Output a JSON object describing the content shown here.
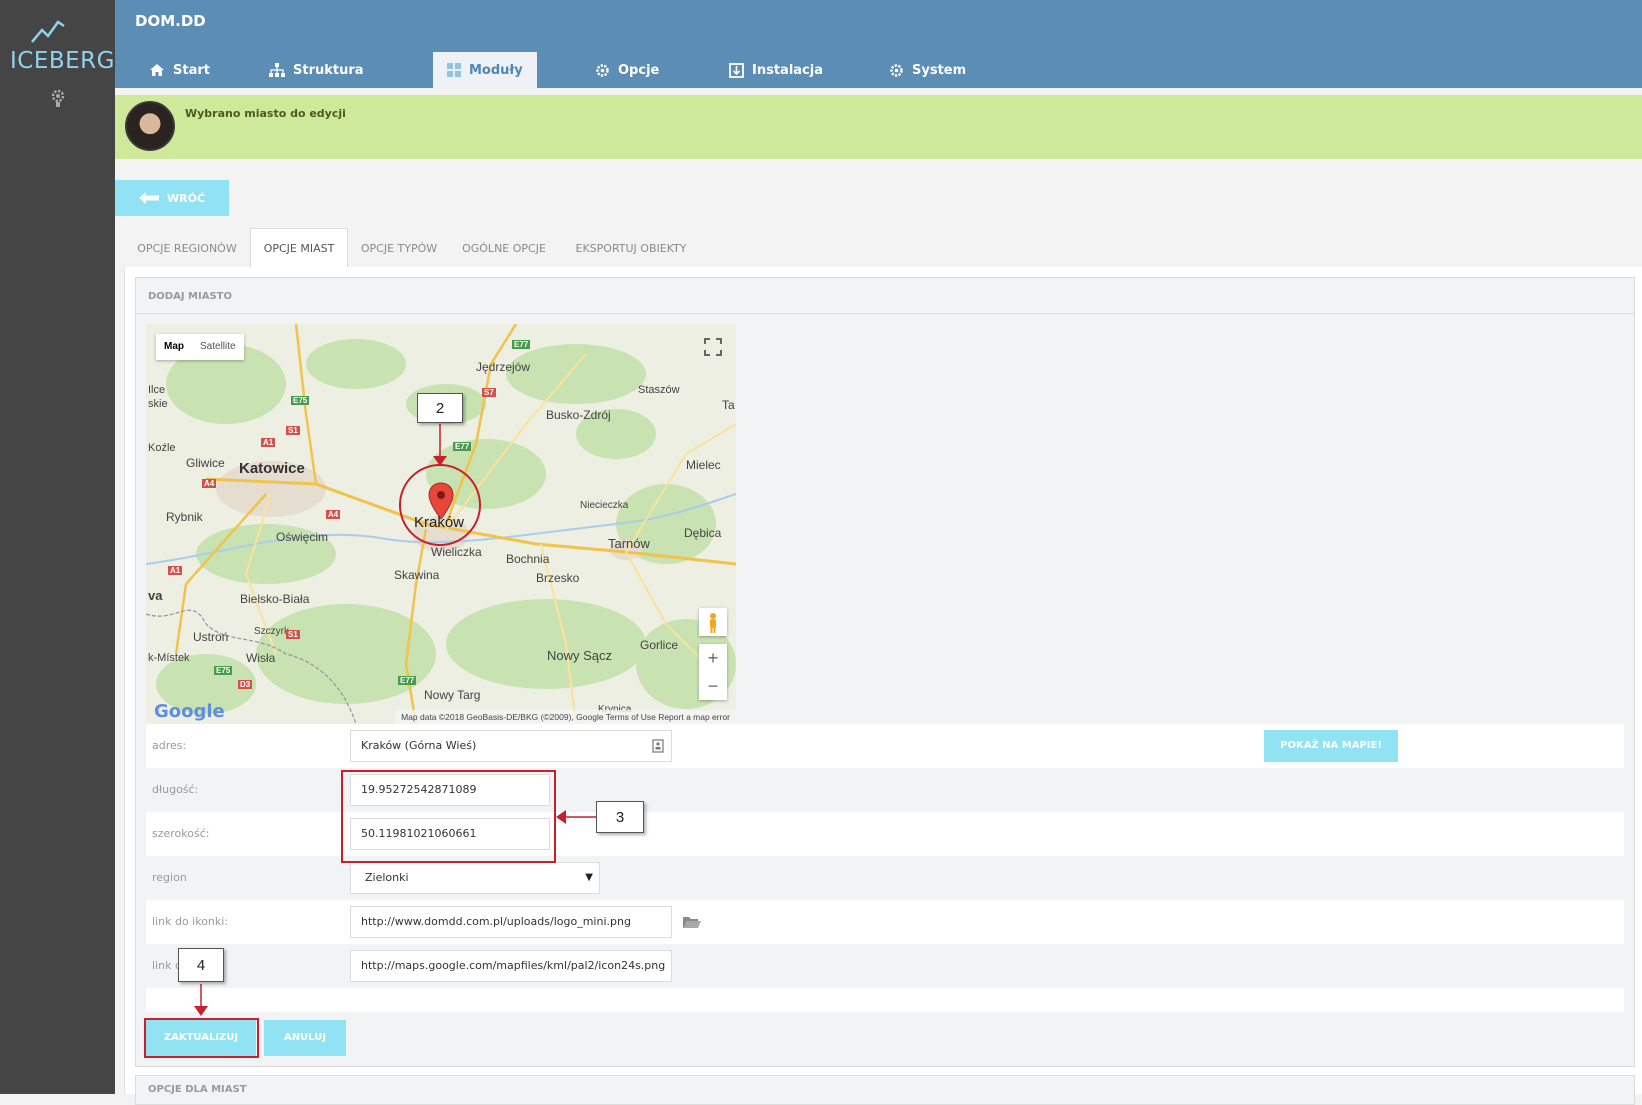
{
  "brand": {
    "name": "ICEBERG"
  },
  "header": {
    "title": "DOM.DD"
  },
  "nav": [
    {
      "label": "Start",
      "icon": "home-icon"
    },
    {
      "label": "Struktura",
      "icon": "sitemap-icon"
    },
    {
      "label": "Moduły",
      "icon": "modules-icon",
      "active": true
    },
    {
      "label": "Opcje",
      "icon": "gear-icon"
    },
    {
      "label": "Instalacja",
      "icon": "install-icon"
    },
    {
      "label": "System",
      "icon": "gear-icon"
    }
  ],
  "notice": {
    "text": "Wybrano miasto do edycji"
  },
  "back_button": {
    "label": "WRÓĆ"
  },
  "tabs": [
    {
      "label": "OPCJE REGIONÓW"
    },
    {
      "label": "OPCJE MIAST",
      "active": true
    },
    {
      "label": "OPCJE TYPÓW"
    },
    {
      "label": "OGÓLNE OPCJE"
    },
    {
      "label": "EKSPORTUJ OBIEKTY"
    }
  ],
  "section": {
    "title": "DODAJ MIASTO",
    "next_title": "OPCJE DLA MIAST"
  },
  "map": {
    "type_map": "Map",
    "type_satellite": "Satellite",
    "footer": "Map data ©2018 GeoBasis-DE/BKG (©2009), Google   Terms of Use   Report a map error",
    "logo": "Google",
    "zoom_in": "+",
    "zoom_out": "−",
    "marker_label": "Kraków",
    "places": [
      "Jędrzejów",
      "Staszów",
      "Busko-Zdrój",
      "Katowice",
      "Gliwice",
      "Rybnik",
      "Oświęcim",
      "Wieliczka",
      "Bochnia",
      "Tarnów",
      "Brzesko",
      "Niecieczka",
      "Mielec",
      "Dębica",
      "Skawina",
      "Bielsko-Biała",
      "Szczyrk",
      "Ustroń",
      "Wisła",
      "Nowy Sącz",
      "Gorlice",
      "Nowy Targ",
      "Krynica",
      "Ilce",
      "skie",
      "Koźle",
      "va",
      "k-Místek",
      "Ta"
    ],
    "road_badges": [
      "E77",
      "E75",
      "S7",
      "S1",
      "A1",
      "A4",
      "E77",
      "A4",
      "A1",
      "S1",
      "E75",
      "D3",
      "E77"
    ]
  },
  "form": {
    "address_label": "adres:",
    "address_value": "Kraków (Górna Wieś)",
    "show_on_map": "POKAŻ NA MAPIE!",
    "longitude_label": "długość:",
    "longitude_value": "19.95272542871089",
    "latitude_label": "szerokość:",
    "latitude_value": "50.11981021060661",
    "region_label": "region",
    "region_value": "Zielonki",
    "icon_link_label": "link do ikonki:",
    "icon_link_value": "http://www.domdd.com.pl/uploads/logo_mini.png",
    "shadow_link_label": "link d",
    "shadow_link_value": "http://maps.google.com/mapfiles/kml/pal2/icon24s.png"
  },
  "actions": {
    "update": "ZAKTUALIZUJ",
    "cancel": "ANULUJ"
  },
  "annotations": [
    "2",
    "3",
    "4"
  ],
  "colors": {
    "header": "#5b8db5",
    "sidebar": "#454545",
    "accent": "#91e3f3",
    "notice": "#cfe99b",
    "annotation": "#c8202a"
  }
}
